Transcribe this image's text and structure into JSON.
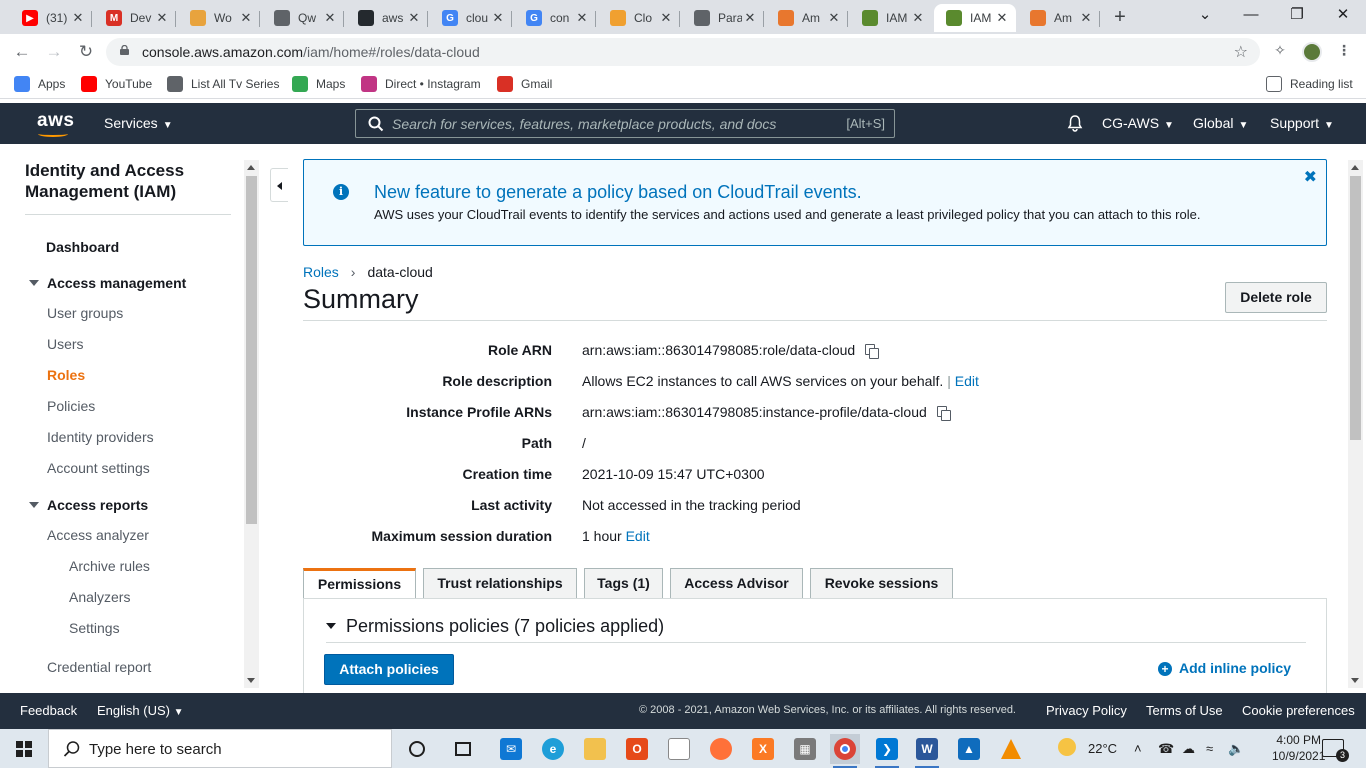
{
  "browser": {
    "tabs": [
      {
        "title": "(31)",
        "icon": "youtube-icon",
        "color": "#ff0000",
        "glyph": "▶"
      },
      {
        "title": "Dev",
        "icon": "gmail-icon",
        "color": "#d93025",
        "glyph": "M"
      },
      {
        "title": "Wo",
        "icon": "aws-box-icon",
        "color": "#e8a33d",
        "glyph": ""
      },
      {
        "title": "Qw",
        "icon": "globe-icon",
        "color": "#5f6368",
        "glyph": ""
      },
      {
        "title": "aws",
        "icon": "github-icon",
        "color": "#24292e",
        "glyph": ""
      },
      {
        "title": "clou",
        "icon": "google-icon",
        "color": "#4285f4",
        "glyph": "G"
      },
      {
        "title": "con",
        "icon": "google-icon",
        "color": "#4285f4",
        "glyph": "G"
      },
      {
        "title": "Clo",
        "icon": "aws-box-icon",
        "color": "#f0a030",
        "glyph": ""
      },
      {
        "title": "Para",
        "icon": "pen-icon",
        "color": "#5f6368",
        "glyph": ""
      },
      {
        "title": "Am",
        "icon": "aws-cube-icon",
        "color": "#e8772e",
        "glyph": ""
      },
      {
        "title": "IAM",
        "icon": "iam-key-icon",
        "color": "#5a8a2e",
        "glyph": ""
      },
      {
        "title": "IAM",
        "icon": "iam-key-icon",
        "color": "#5a8a2e",
        "glyph": ""
      },
      {
        "title": "Am",
        "icon": "aws-cube-icon",
        "color": "#e8772e",
        "glyph": ""
      }
    ],
    "url_host": "console.aws.amazon.com",
    "url_path": "/iam/home#/roles/data-cloud",
    "bookmarks": [
      {
        "label": "Apps",
        "icon": "apps-grid-icon",
        "color": "#4285f4"
      },
      {
        "label": "YouTube",
        "icon": "youtube-icon",
        "color": "#ff0000"
      },
      {
        "label": "List All Tv Series",
        "icon": "list-icon",
        "color": "#5f6368"
      },
      {
        "label": "Maps",
        "icon": "maps-pin-icon",
        "color": "#34a853"
      },
      {
        "label": "Direct • Instagram",
        "icon": "instagram-icon",
        "color": "#c13584"
      },
      {
        "label": "Gmail",
        "icon": "gmail-icon",
        "color": "#d93025"
      }
    ],
    "reading_list": "Reading list"
  },
  "aws_nav": {
    "logo": "aws",
    "services": "Services",
    "search_placeholder": "Search for services, features, marketplace products, and docs",
    "search_hint": "[Alt+S]",
    "account": "CG-AWS",
    "region": "Global",
    "support": "Support"
  },
  "sidebar": {
    "title": "Identity and Access Management (IAM)",
    "dashboard": "Dashboard",
    "access_management": "Access management",
    "access_management_items": [
      "User groups",
      "Users",
      "Roles",
      "Policies",
      "Identity providers",
      "Account settings"
    ],
    "active_item": "Roles",
    "access_reports": "Access reports",
    "access_analyzer": "Access analyzer",
    "analyzer_items": [
      "Archive rules",
      "Analyzers",
      "Settings"
    ],
    "credential_report": "Credential report"
  },
  "flash": {
    "heading": "New feature to generate a policy based on CloudTrail events.",
    "body": "AWS uses your CloudTrail events to identify the services and actions used and generate a least privileged policy that you can attach to this role."
  },
  "breadcrumb": {
    "parent": "Roles",
    "current": "data-cloud"
  },
  "page_title": "Summary",
  "delete_role": "Delete role",
  "details": [
    {
      "label": "Role ARN",
      "value": "arn:aws:iam::863014798085:role/data-cloud",
      "copy": true
    },
    {
      "label": "Role description",
      "value": "Allows EC2 instances to call AWS services on your behalf.",
      "link": "Edit",
      "sep": " | "
    },
    {
      "label": "Instance Profile ARNs",
      "value": "arn:aws:iam::863014798085:instance-profile/data-cloud",
      "copy": true
    },
    {
      "label": "Path",
      "value": "/"
    },
    {
      "label": "Creation time",
      "value": "2021-10-09 15:47 UTC+0300"
    },
    {
      "label": "Last activity",
      "value": "Not accessed in the tracking period"
    },
    {
      "label": "Maximum session duration",
      "value": "1 hour",
      "link": "Edit",
      "sep": " "
    }
  ],
  "tabs": [
    "Permissions",
    "Trust relationships",
    "Tags (1)",
    "Access Advisor",
    "Revoke sessions"
  ],
  "active_tab": "Permissions",
  "permissions": {
    "heading": "Permissions policies (7 policies applied)",
    "attach": "Attach policies",
    "add_inline": "Add inline policy"
  },
  "footer": {
    "feedback": "Feedback",
    "language": "English (US)",
    "copyright": "© 2008 - 2021, Amazon Web Services, Inc. or its affiliates. All rights reserved.",
    "privacy": "Privacy Policy",
    "terms": "Terms of Use",
    "cookies": "Cookie preferences"
  },
  "taskbar": {
    "search_placeholder": "Type here to search",
    "weather": "22°C",
    "time": "4:00 PM",
    "date": "10/9/2021",
    "notifications": "3"
  },
  "colors": {
    "aws_dark": "#232f3e",
    "aws_orange": "#ec7211",
    "link_blue": "#0073bb"
  }
}
